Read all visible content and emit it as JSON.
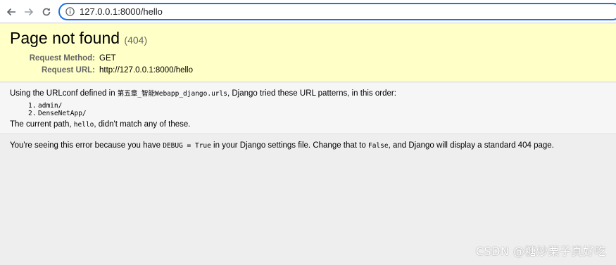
{
  "browser": {
    "url": "127.0.0.1:8000/hello",
    "icons": [
      "back-arrow-icon",
      "forward-arrow-icon",
      "reload-icon",
      "info-icon"
    ]
  },
  "summary": {
    "title": "Page not found",
    "status_code": "(404)",
    "request_method_label": "Request Method:",
    "request_method": "GET",
    "request_url_label": "Request URL:",
    "request_url": "http://127.0.0.1:8000/hello"
  },
  "info": {
    "intro_before": "Using the URLconf defined in ",
    "urlconf": "第五章_智能Webapp_django.urls",
    "intro_after": ", Django tried these URL patterns, in this order:",
    "patterns": [
      {
        "num": "1.",
        "text": "admin/"
      },
      {
        "num": "2.",
        "text": "DenseNetApp/"
      }
    ],
    "current_before": "The current path, ",
    "current_path": "hello",
    "current_after": ", didn't match any of these."
  },
  "explanation": {
    "part1": "You're seeing this error because you have ",
    "debug_setting": "DEBUG = True",
    "part2": " in your Django settings file. Change that to ",
    "false_value": "False",
    "part3": ", and Django will display a standard 404 page."
  },
  "watermark": "CSDN @糖炒栗子真好吃"
}
